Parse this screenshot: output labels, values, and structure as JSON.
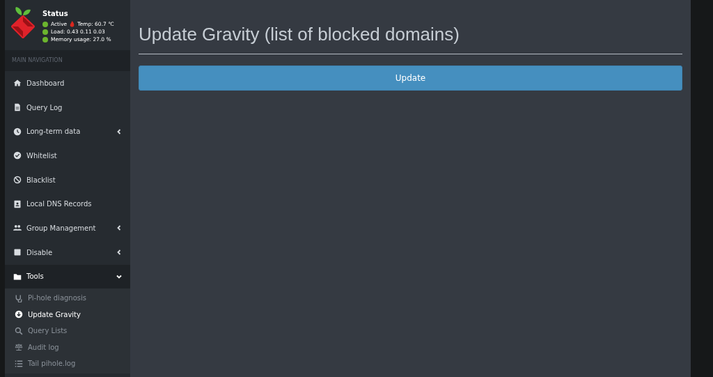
{
  "status": {
    "title": "Status",
    "lines": [
      {
        "text": "Active",
        "temp": "Temp: 60.7 ℃"
      },
      {
        "text": "Load:  0.43  0.11  0.03"
      },
      {
        "text": "Memory usage:  27.0 %"
      }
    ]
  },
  "nav_header": "MAIN NAVIGATION",
  "menu": [
    {
      "label": "Dashboard",
      "kind": "home"
    },
    {
      "label": "Query Log",
      "kind": "file"
    },
    {
      "label": "Long-term data",
      "kind": "clock",
      "expanded": false
    },
    {
      "label": "Whitelist",
      "kind": "check"
    },
    {
      "label": "Blacklist",
      "kind": "ban"
    },
    {
      "label": "Local DNS Records",
      "kind": "contact"
    },
    {
      "label": "Group Management",
      "kind": "users",
      "expanded": false
    },
    {
      "label": "Disable",
      "kind": "square",
      "expanded": false
    },
    {
      "label": "Tools",
      "kind": "folder",
      "expanded": true,
      "children": [
        {
          "label": "Pi-hole diagnosis",
          "kind": "stethoscope",
          "selected": false
        },
        {
          "label": "Update Gravity",
          "kind": "download",
          "selected": true
        },
        {
          "label": "Query Lists",
          "kind": "search",
          "selected": false
        },
        {
          "label": "Audit log",
          "kind": "scale",
          "selected": false
        },
        {
          "label": "Tail pihole.log",
          "kind": "list",
          "selected": false
        }
      ]
    }
  ],
  "page": {
    "title": "Update Gravity (list of blocked domains)",
    "button": "Update"
  }
}
